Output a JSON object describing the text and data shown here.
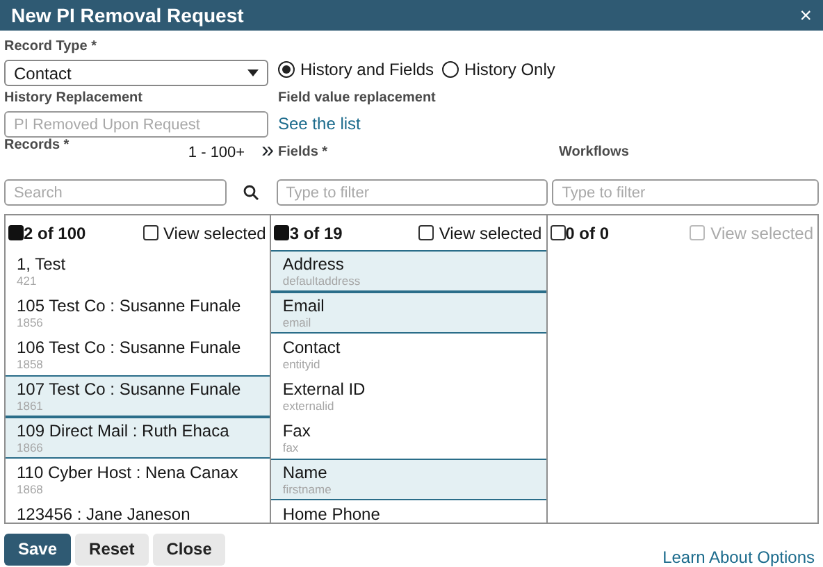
{
  "window": {
    "title": "New PI Removal Request",
    "close": "×"
  },
  "record_type": {
    "label": "Record Type *",
    "value": "Contact"
  },
  "mode_options": [
    {
      "label": "History and Fields",
      "selected": true
    },
    {
      "label": "History Only",
      "selected": false
    }
  ],
  "history_replacement": {
    "label": "History Replacement",
    "placeholder": "PI Removed Upon Request"
  },
  "field_value_replacement": {
    "label": "Field value replacement",
    "link": "See the list"
  },
  "records": {
    "label": "Records *",
    "range": "1 - 100+",
    "next": "»",
    "search_placeholder": "Search",
    "count": "2 of 100",
    "header_checked": true,
    "view_selected": {
      "label": "View selected",
      "checked": false,
      "disabled": false
    },
    "items": [
      {
        "name": "1, Test",
        "sub": "421",
        "selected": false
      },
      {
        "name": "105 Test Co : Susanne Funale",
        "sub": "1856",
        "selected": false
      },
      {
        "name": "106 Test Co : Susanne Funale",
        "sub": "1858",
        "selected": false
      },
      {
        "name": "107 Test Co : Susanne Funale",
        "sub": "1861",
        "selected": true
      },
      {
        "name": "109 Direct Mail : Ruth Ehaca",
        "sub": "1866",
        "selected": true
      },
      {
        "name": "110 Cyber Host : Nena Canax",
        "sub": "1868",
        "selected": false
      },
      {
        "name": "123456 : Jane Janeson",
        "selected": false
      }
    ]
  },
  "fields": {
    "label": "Fields *",
    "filter_placeholder": "Type to filter",
    "count": "3 of 19",
    "header_checked": true,
    "view_selected": {
      "label": "View selected",
      "checked": false,
      "disabled": false
    },
    "items": [
      {
        "name": "Address",
        "sub": "defaultaddress",
        "selected": true
      },
      {
        "name": "Email",
        "sub": "email",
        "selected": true
      },
      {
        "name": "Contact",
        "sub": "entityid",
        "selected": false
      },
      {
        "name": "External ID",
        "sub": "externalid",
        "selected": false
      },
      {
        "name": "Fax",
        "sub": "fax",
        "selected": false
      },
      {
        "name": "Name",
        "sub": "firstname",
        "selected": true
      },
      {
        "name": "Home Phone",
        "selected": false
      }
    ]
  },
  "workflows": {
    "label": "Workflows",
    "filter_placeholder": "Type to filter",
    "count": "0 of 0",
    "header_checked": false,
    "view_selected": {
      "label": "View selected",
      "checked": false,
      "disabled": true
    }
  },
  "buttons": [
    {
      "label": "Save",
      "kind": "primary"
    },
    {
      "label": "Reset",
      "kind": "secondary"
    },
    {
      "label": "Close",
      "kind": "secondary"
    }
  ],
  "footer_link": "Learn About Options"
}
